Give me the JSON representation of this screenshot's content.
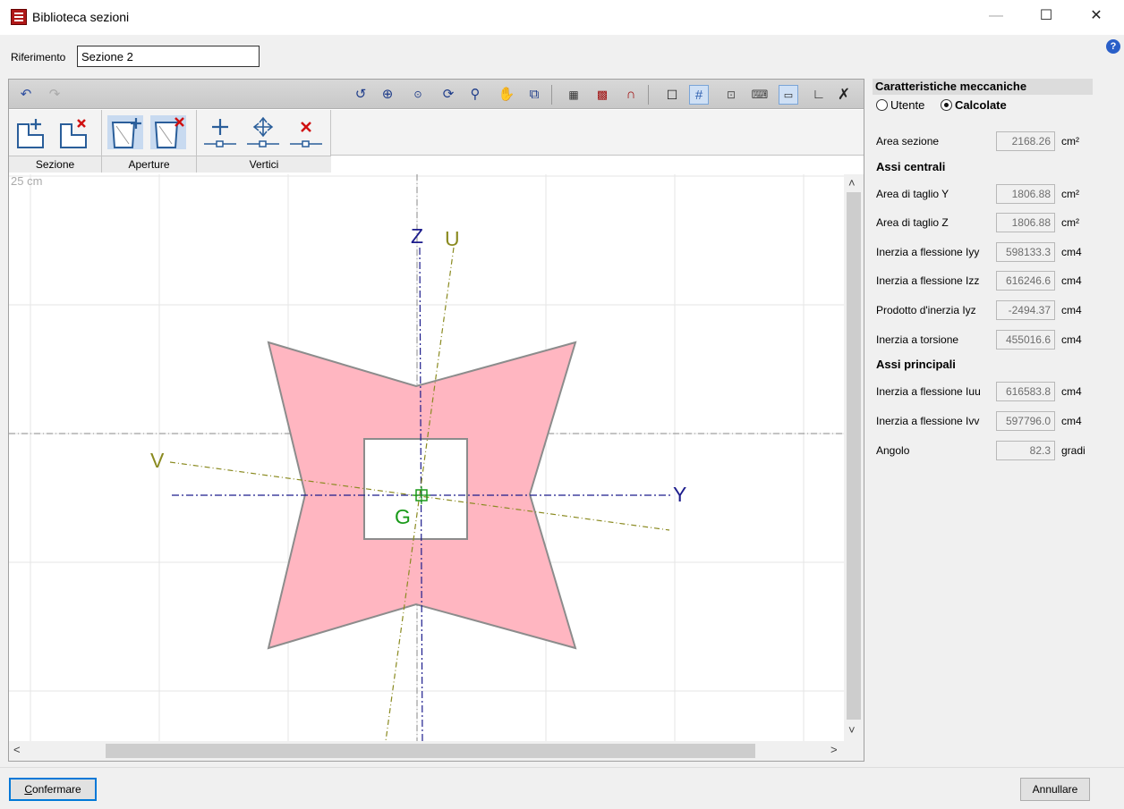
{
  "window": {
    "title": "Biblioteca sezioni",
    "minimize": "—",
    "maximize": "☐",
    "close": "✕",
    "help": "?"
  },
  "reference": {
    "label": "Riferimento",
    "value": "Sezione 2"
  },
  "ribbon": {
    "groups": [
      {
        "label": "Sezione"
      },
      {
        "label": "Aperture"
      },
      {
        "label": "Vertici"
      }
    ]
  },
  "canvas": {
    "scale_label": "25 cm",
    "axis_labels": {
      "z": "Z",
      "u": "U",
      "v": "V",
      "y": "Y",
      "g": "G"
    },
    "colors": {
      "section_fill": "#ffb6c1",
      "section_stroke": "#8c8c8c",
      "axis_yz": "#1c1c8c",
      "axis_uv": "#8a8a20",
      "centroid": "#1a9a1a"
    }
  },
  "panel": {
    "title": "Caratteristiche meccaniche",
    "mode_options": [
      {
        "label": "Utente",
        "selected": false
      },
      {
        "label": "Calcolate",
        "selected": true
      }
    ],
    "area": {
      "label": "Area sezione",
      "value": "2168.26",
      "unit": "cm²"
    },
    "central_title": "Assi centrali",
    "central": [
      {
        "label": "Area di taglio Y",
        "value": "1806.88",
        "unit": "cm²"
      },
      {
        "label": "Area di taglio Z",
        "value": "1806.88",
        "unit": "cm²"
      },
      {
        "label": "Inerzia a flessione Iyy",
        "value": "598133.3",
        "unit": "cm4"
      },
      {
        "label": "Inerzia a flessione Izz",
        "value": "616246.6",
        "unit": "cm4"
      },
      {
        "label": "Prodotto d'inerzia Iyz",
        "value": "-2494.37",
        "unit": "cm4"
      },
      {
        "label": "Inerzia a torsione",
        "value": "455016.6",
        "unit": "cm4"
      }
    ],
    "principal_title": "Assi principali",
    "principal": [
      {
        "label": "Inerzia a flessione Iuu",
        "value": "616583.8",
        "unit": "cm4"
      },
      {
        "label": "Inerzia a flessione Ivv",
        "value": "597796.0",
        "unit": "cm4"
      },
      {
        "label": "Angolo",
        "value": "82.3",
        "unit": "gradi"
      }
    ]
  },
  "buttons": {
    "confirm": "Confermare",
    "cancel": "Annullare"
  }
}
